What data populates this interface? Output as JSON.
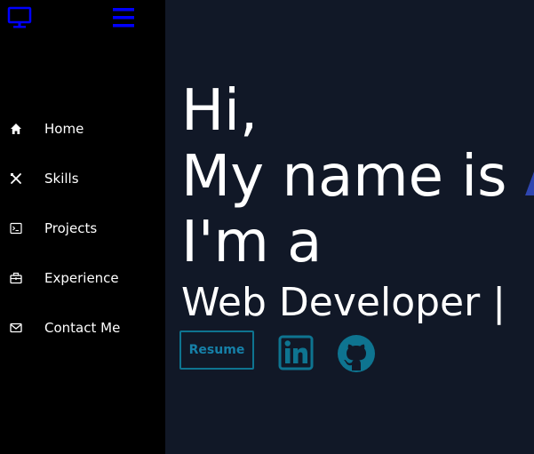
{
  "sidebar": {
    "logo_icon": "monitor-icon",
    "menu_icon": "hamburger-menu-icon",
    "items": [
      {
        "label": "Home",
        "icon": "home-icon"
      },
      {
        "label": "Skills",
        "icon": "tools-icon"
      },
      {
        "label": "Projects",
        "icon": "terminal-icon"
      },
      {
        "label": "Experience",
        "icon": "briefcase-icon"
      },
      {
        "label": "Contact Me",
        "icon": "mail-icon"
      }
    ]
  },
  "hero": {
    "line1": "Hi,",
    "line2_prefix": "My name is ",
    "name_visible": "A",
    "line3": "I'm a",
    "role_text": "Web Developer |"
  },
  "actions": {
    "resume_label": "Resume",
    "linkedin_icon": "linkedin-icon",
    "github_icon": "github-icon"
  },
  "colors": {
    "sidebar_bg": "#000000",
    "main_bg": "#111827",
    "accent_blue": "#0000ff",
    "name_blue": "#2f46b0",
    "cyan": "#0e7490"
  }
}
